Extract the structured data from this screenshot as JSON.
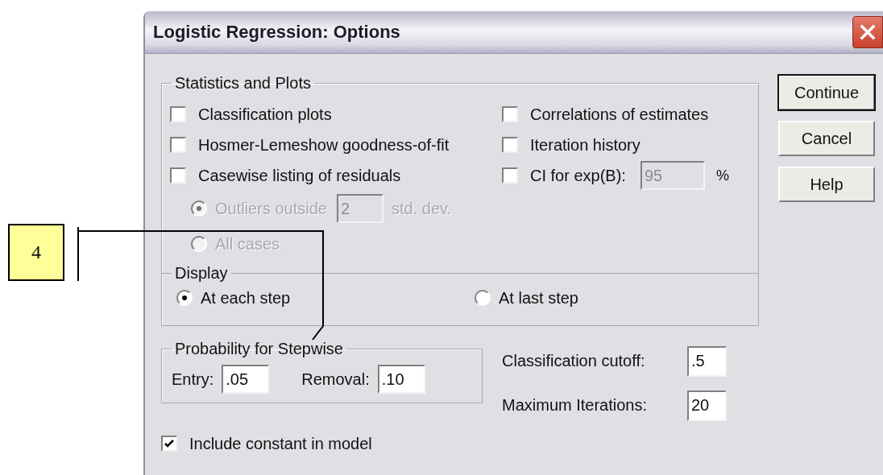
{
  "window": {
    "title": "Logistic Regression: Options"
  },
  "statistics_and_plots": {
    "title": "Statistics and Plots",
    "left_options": [
      {
        "label": "Classification plots",
        "checked": false
      },
      {
        "label": "Hosmer-Lemeshow goodness-of-fit",
        "checked": false
      },
      {
        "label": "Casewise listing of residuals",
        "checked": false
      }
    ],
    "casewise_options": [
      {
        "label": "Outliers outside",
        "selected": true,
        "disabled": true,
        "value": "2",
        "suffix": "std. dev."
      },
      {
        "label": "All cases",
        "selected": false,
        "disabled": true
      }
    ],
    "right_options": [
      {
        "label": "Correlations of estimates",
        "checked": false
      },
      {
        "label": "Iteration history",
        "checked": false
      },
      {
        "label": "CI for exp(B):",
        "checked": false,
        "value": "95",
        "value_disabled": true,
        "suffix": "%"
      }
    ]
  },
  "display": {
    "title": "Display",
    "options": [
      {
        "label": "At each step",
        "selected": true
      },
      {
        "label": "At last step",
        "selected": false
      }
    ]
  },
  "probability_for_stepwise": {
    "title": "Probability for Stepwise",
    "fields": [
      {
        "label": "Entry:",
        "value": ".05"
      },
      {
        "label": "Removal:",
        "value": ".10"
      }
    ]
  },
  "settings": [
    {
      "label": "Classification cutoff:",
      "value": ".5"
    },
    {
      "label": "Maximum Iterations:",
      "value": "20"
    }
  ],
  "include_constant": {
    "label": "Include constant in model",
    "checked": true
  },
  "buttons": [
    {
      "label": "Continue",
      "default": true
    },
    {
      "label": "Cancel",
      "default": false
    },
    {
      "label": "Help",
      "default": false
    }
  ],
  "callout": {
    "label": "4"
  }
}
